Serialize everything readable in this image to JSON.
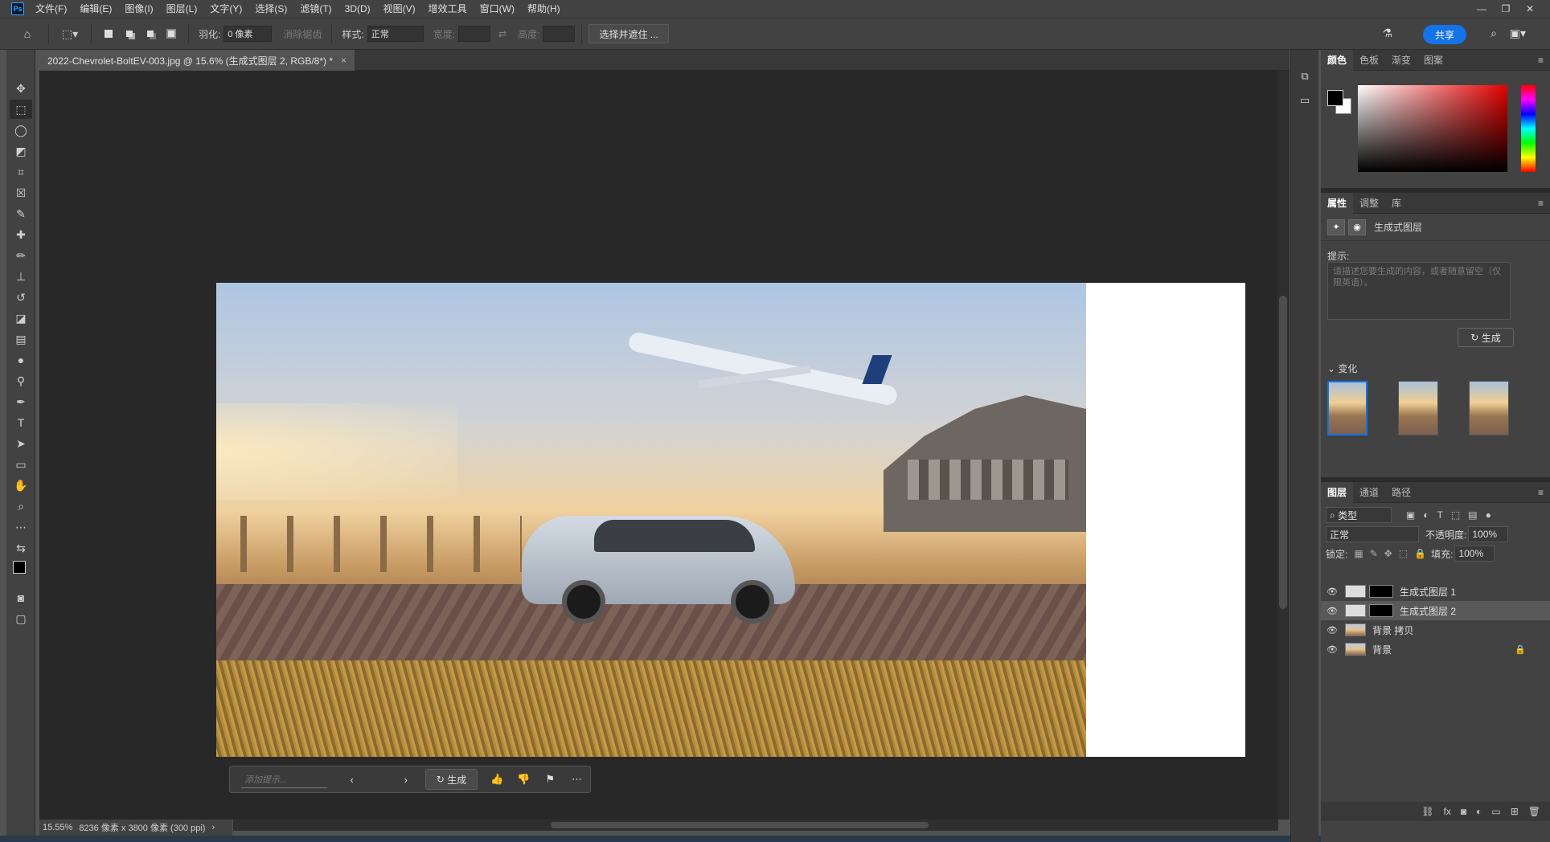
{
  "menubar": {
    "logo": "Ps",
    "items": [
      "文件(F)",
      "编辑(E)",
      "图像(I)",
      "图层(L)",
      "文字(Y)",
      "选择(S)",
      "滤镜(T)",
      "3D(D)",
      "视图(V)",
      "增效工具",
      "窗口(W)",
      "帮助(H)"
    ]
  },
  "options": {
    "feather_label": "羽化:",
    "feather_value": "0 像素",
    "antialias_label": "消除锯齿",
    "style_label": "样式:",
    "style_value": "正常",
    "width_label": "宽度:",
    "height_label": "高度:",
    "select_mask_label": "选择并遮住 ...",
    "share_label": "共享"
  },
  "document": {
    "tab_title": "2022-Chevrolet-BoltEV-003.jpg @ 15.6% (生成式图层 2, RGB/8*) *",
    "close": "×"
  },
  "generative_bar": {
    "placeholder": "添加提示...",
    "generate_label": "生成"
  },
  "status": {
    "zoom": "15.55%",
    "doc_info": "8236 像素 x 3800 像素 (300 ppi)"
  },
  "color_panel": {
    "tabs": [
      "颜色",
      "色板",
      "渐变",
      "图案"
    ],
    "fg_color": "#000000",
    "bg_color": "#ffffff"
  },
  "properties_panel": {
    "tabs": [
      "属性",
      "调整",
      "库"
    ],
    "layer_type": "生成式图层",
    "prompt_label": "提示:",
    "prompt_placeholder": "请描述您要生成的内容，或者随意留空（仅限英语）。",
    "generate_label": "生成",
    "variations_label": "变化"
  },
  "layers_panel": {
    "tabs": [
      "图层",
      "通道",
      "路径"
    ],
    "filter_label": "类型",
    "blend_mode": "正常",
    "opacity_label": "不透明度:",
    "opacity_value": "100%",
    "lock_label": "锁定:",
    "fill_label": "填充:",
    "fill_value": "100%",
    "layers": [
      {
        "name": "生成式图层 1",
        "selected": false
      },
      {
        "name": "生成式图层 2",
        "selected": true
      },
      {
        "name": "背景 拷贝",
        "selected": false
      },
      {
        "name": "背景",
        "selected": false
      }
    ]
  },
  "accent_color": "#1473e6"
}
